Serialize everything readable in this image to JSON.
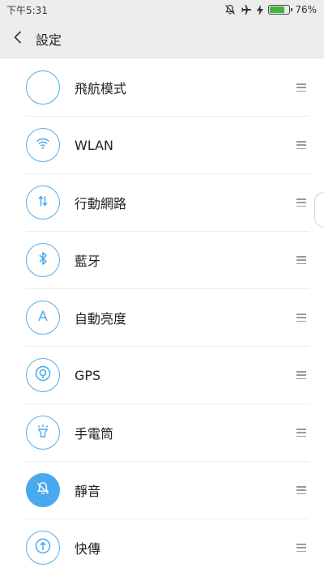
{
  "status_bar": {
    "time": "下午5:31",
    "icons": [
      "bell-off-icon",
      "airplane-icon",
      "charging-bolt-icon",
      "battery-icon"
    ],
    "battery_percent": "76%",
    "battery_level": 0.76,
    "battery_color": "#3fb63f"
  },
  "header": {
    "back_icon": "chevron-left-icon",
    "title": "設定"
  },
  "accent_color": "#48a9ec",
  "items": [
    {
      "label": "飛航模式",
      "icon": "airplane-icon",
      "active": true
    },
    {
      "label": "WLAN",
      "icon": "wifi-icon",
      "active": false
    },
    {
      "label": "行動網路",
      "icon": "mobile-data-arrows-icon",
      "active": false
    },
    {
      "label": "藍牙",
      "icon": "bluetooth-icon",
      "active": false
    },
    {
      "label": "自動亮度",
      "icon": "auto-brightness-icon",
      "active": false
    },
    {
      "label": "GPS",
      "icon": "location-icon",
      "active": false
    },
    {
      "label": "手電筒",
      "icon": "flashlight-icon",
      "active": false
    },
    {
      "label": "靜音",
      "icon": "bell-off-icon",
      "active": true
    },
    {
      "label": "快傳",
      "icon": "share-upload-icon",
      "active": false
    }
  ]
}
